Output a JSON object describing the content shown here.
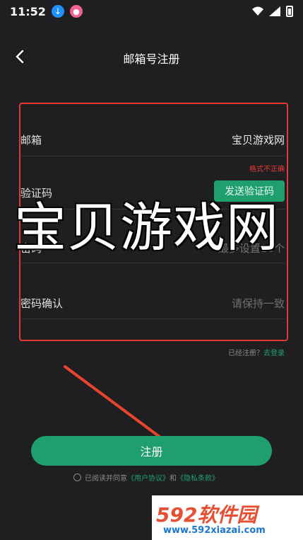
{
  "status_bar": {
    "time": "11:52",
    "download_icon": "↓",
    "app_icon": "●"
  },
  "header": {
    "title": "邮箱号注册"
  },
  "form": {
    "email": {
      "label": "邮箱",
      "value": "宝贝游戏网",
      "error": "格式不正确"
    },
    "code": {
      "label": "验证码",
      "button": "发送验证码"
    },
    "password": {
      "label": "密码",
      "placeholder": "最多设置16个"
    },
    "confirm": {
      "label": "密码确认",
      "placeholder": "请保持一致"
    }
  },
  "login": {
    "prompt": "已经注册？",
    "link": "去登录"
  },
  "register_button": "注册",
  "agreement": {
    "prefix": "已阅读并同意",
    "user_agreement": "《用户协议》",
    "and": "和",
    "privacy": "《隐私条款》"
  },
  "watermark": "宝贝游戏网",
  "site_logo": {
    "top": "592软件园",
    "bottom": "www.592xiazai.com"
  },
  "colors": {
    "accent": "#1f9e6e",
    "error": "#e53935",
    "background": "#1f1f21"
  }
}
